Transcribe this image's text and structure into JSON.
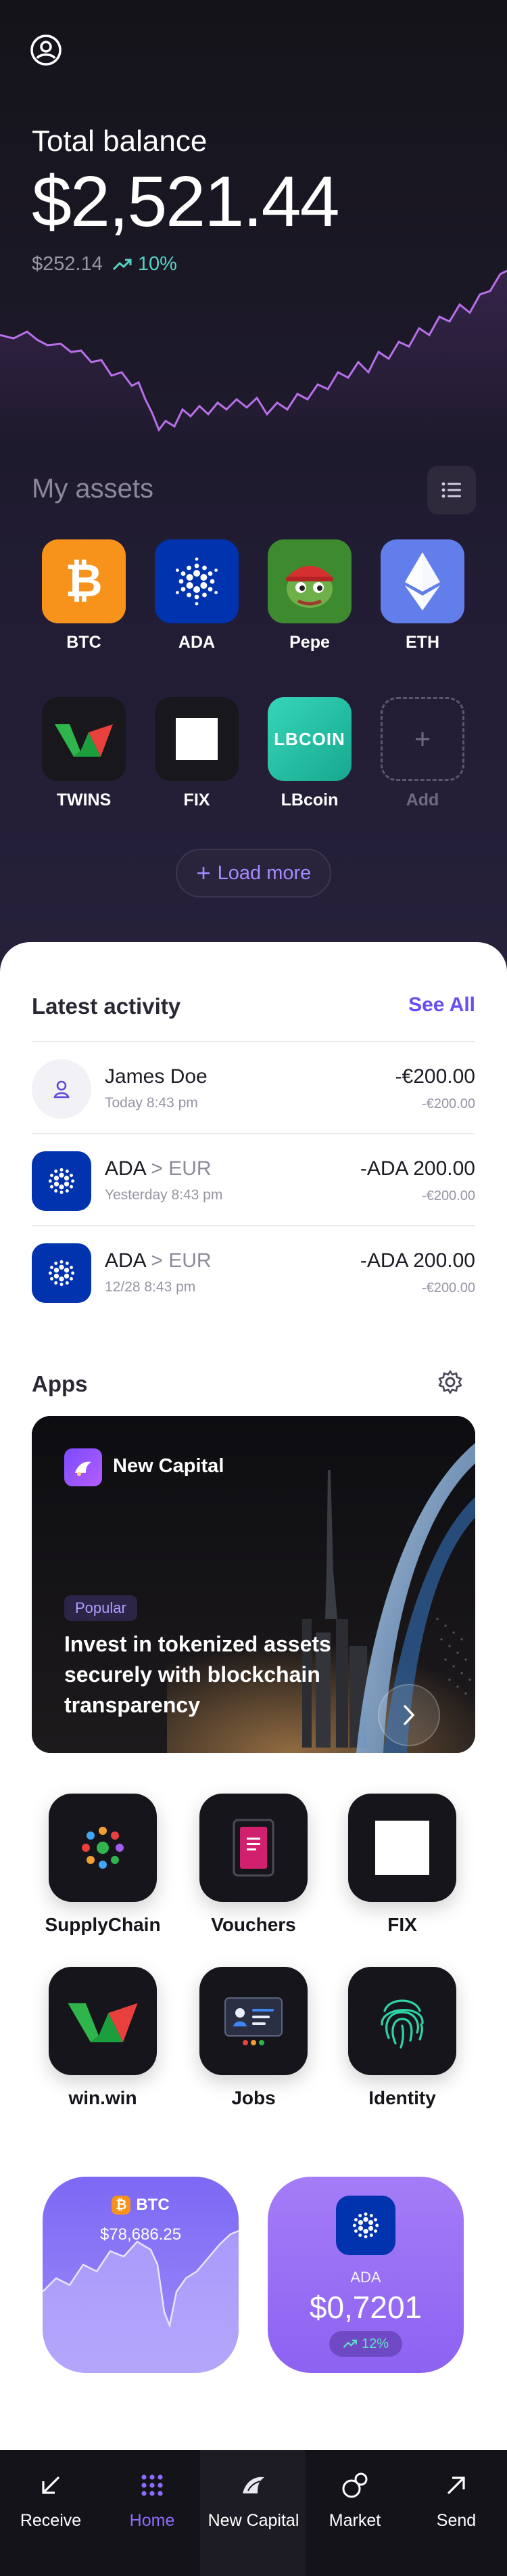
{
  "balance": {
    "label": "Total balance",
    "value": "$2,521.44",
    "change_amount": "$252.14",
    "change_percent": "10%"
  },
  "assets": {
    "title": "My assets",
    "items": [
      {
        "name": "BTC"
      },
      {
        "name": "ADA"
      },
      {
        "name": "Pepe"
      },
      {
        "name": "ETH"
      },
      {
        "name": "TWINS"
      },
      {
        "name": "FIX"
      },
      {
        "name": "LBcoin",
        "tile_text": "LBCOIN"
      },
      {
        "name": "Add"
      }
    ],
    "load_more": "Load more"
  },
  "activity": {
    "title": "Latest activity",
    "see_all": "See All",
    "items": [
      {
        "title": "James Doe",
        "title_suffix": "",
        "subtitle": "Today 8:43 pm",
        "amount": "-€200.00",
        "amount_sub": "-€200.00"
      },
      {
        "title": "ADA",
        "title_suffix": " > EUR",
        "subtitle": "Yesterday 8:43 pm",
        "amount": "-ADA 200.00",
        "amount_sub": "-€200.00"
      },
      {
        "title": "ADA",
        "title_suffix": " > EUR",
        "subtitle": "12/28 8:43 pm",
        "amount": "-ADA 200.00",
        "amount_sub": "-€200.00"
      }
    ]
  },
  "apps": {
    "title": "Apps",
    "banner": {
      "brand": "New Capital",
      "badge": "Popular",
      "headline": "Invest in tokenized assets securely with blockchain transparency"
    },
    "items": [
      {
        "name": "SupplyChain"
      },
      {
        "name": "Vouchers"
      },
      {
        "name": "FIX"
      },
      {
        "name": "win.win"
      },
      {
        "name": "Jobs"
      },
      {
        "name": "Identity"
      }
    ]
  },
  "cards": {
    "btc": {
      "symbol": "BTC",
      "value": "$78,686.25"
    },
    "ada": {
      "symbol": "ADA",
      "value": "$0,7201",
      "change": "12%"
    }
  },
  "nav": {
    "items": [
      {
        "label": "Receive",
        "icon": "arrow-down-left-icon"
      },
      {
        "label": "Home",
        "icon": "grid-icon",
        "active": true
      },
      {
        "label": "New Capital",
        "icon": "new-capital-logo-icon"
      },
      {
        "label": "Market",
        "icon": "market-icon"
      },
      {
        "label": "Send",
        "icon": "arrow-up-right-icon"
      }
    ]
  },
  "colors": {
    "accent": "#6a4cf6",
    "positive": "#58d3c5",
    "btc": "#f7931a",
    "ada": "#0033ad",
    "eth": "#627eea"
  }
}
